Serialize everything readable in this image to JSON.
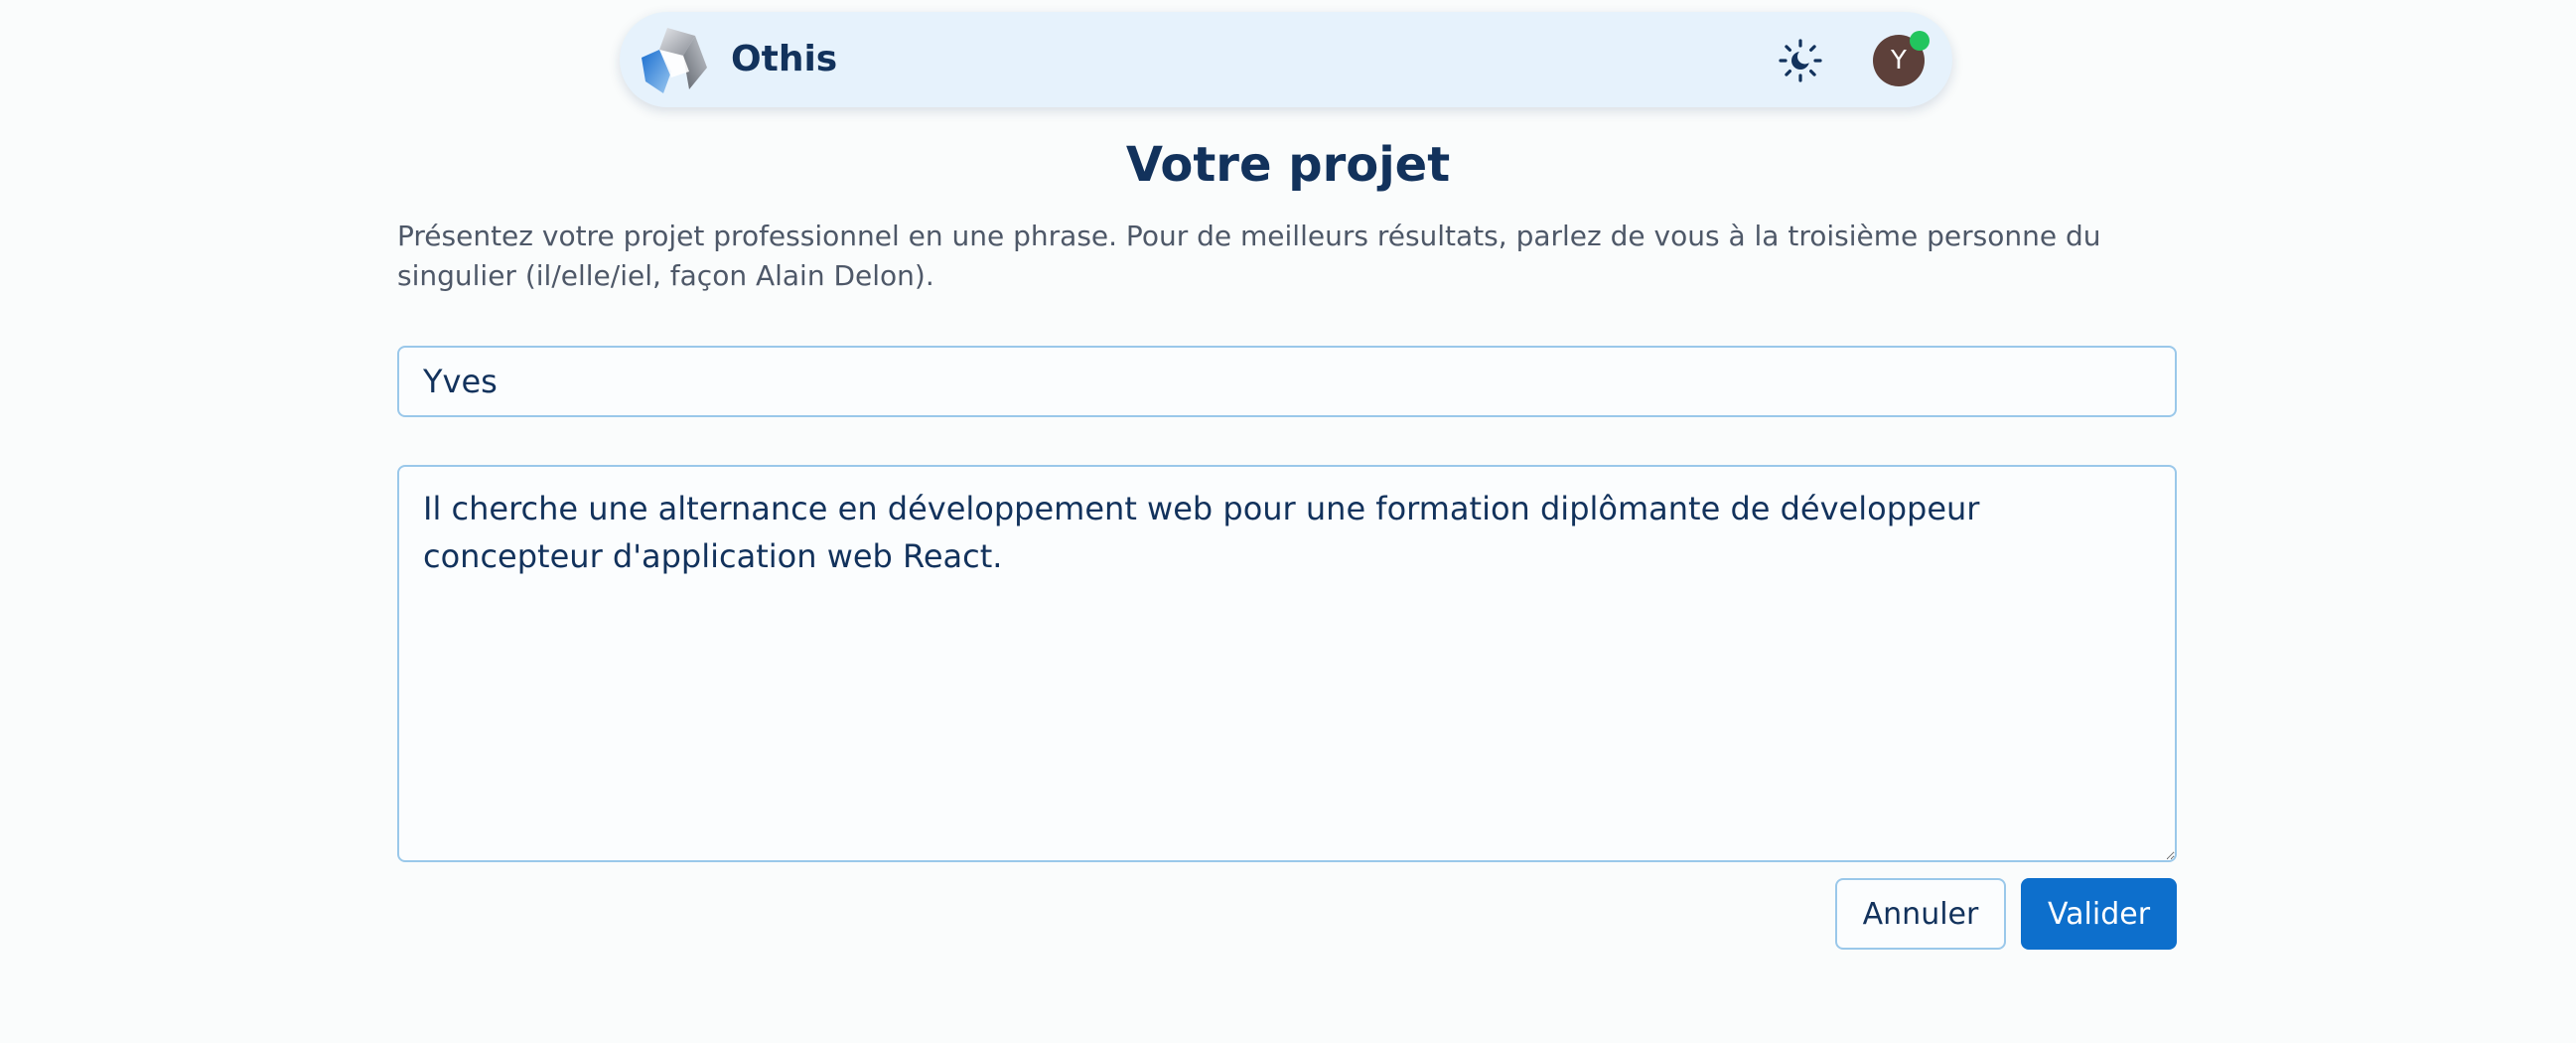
{
  "header": {
    "brand": "Othis",
    "avatar_initial": "Y",
    "colors": {
      "accent": "#0d6fcc",
      "online": "#22c55e",
      "avatar_bg": "#5d403a"
    }
  },
  "main": {
    "title": "Votre projet",
    "description": "Présentez votre projet professionnel en une phrase. Pour de meilleurs résultats, parlez de vous à la troisième personne du singulier (il/elle/iel, façon Alain Delon).",
    "name_value": "Yves",
    "project_value": "Il cherche une alternance en développement web pour une formation diplômante de développeur concepteur d'application web React."
  },
  "actions": {
    "cancel_label": "Annuler",
    "submit_label": "Valider"
  },
  "icons": {
    "logo": "othis-logo-icon",
    "theme": "theme-toggle-icon"
  }
}
